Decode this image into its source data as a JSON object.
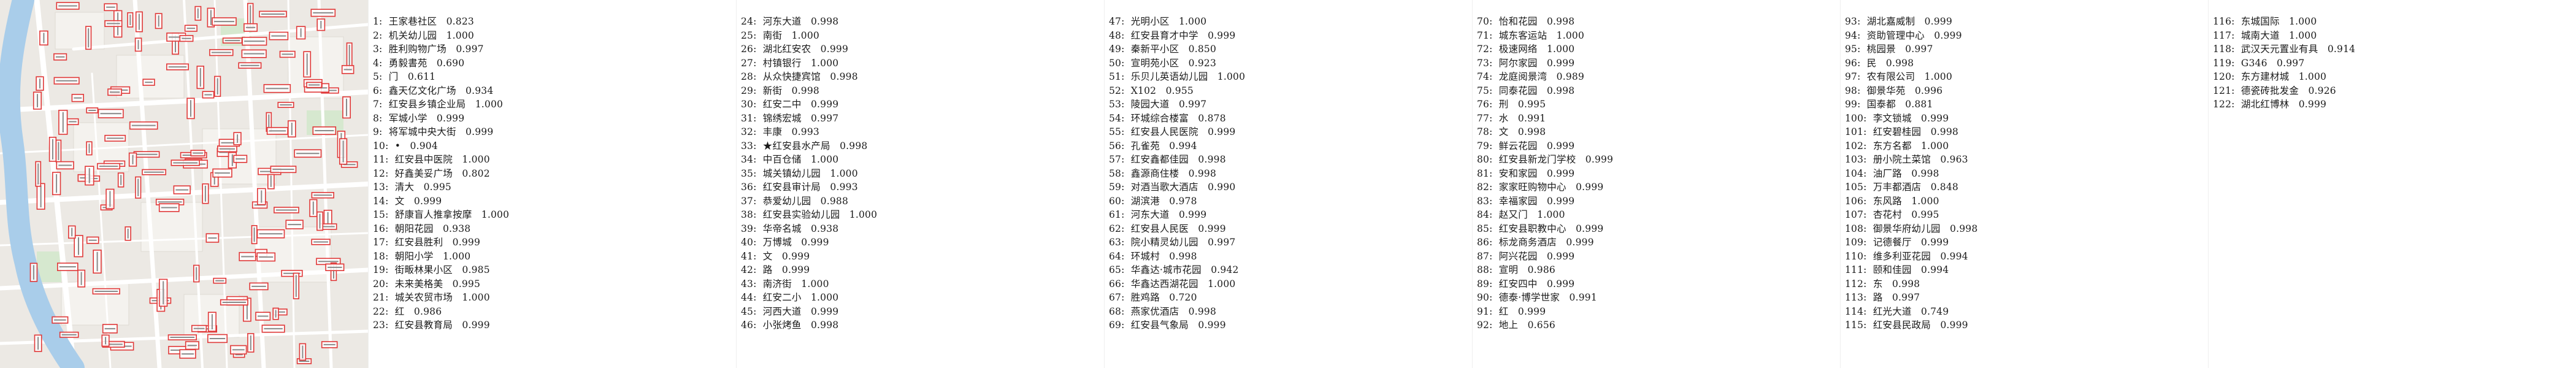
{
  "colors": {
    "map_background": "#ece9e4",
    "river": "#a9cdea",
    "road": "#ffffff",
    "label_box_border": "#e03838",
    "text": "#1a1a1a"
  },
  "map": {
    "label_icon": "red-outlined-label-box-icon"
  },
  "columns": [
    [
      "1:  王家巷社区   0.823",
      "2:  机关幼儿园   1.000",
      "3:  胜利购物广场   0.997",
      "4:  勇毅書苑   0.690",
      "5:  门   0.611",
      "6:  鑫天亿文化广场   0.934",
      "7:  红安县乡镇企业局   1.000",
      "8:  军城小学   0.999",
      "9:  将军城中央大街   0.999",
      "10:  •   0.904",
      "11:  红安县中医院   1.000",
      "12:  好鑫美妥广场   0.802",
      "13:  清大   0.995",
      "14:  文   0.999",
      "15:  舒康盲人推拿按摩   1.000",
      "16:  朝阳花园   0.938",
      "17:  红安县胜利   0.999",
      "18:  朝阳小学   1.000",
      "19:  街畈林果小区   0.985",
      "20:  未来美格美   0.995",
      "21:  城关农贸市场   1.000",
      "22:  红   0.986",
      "23:  红安县教育局   0.999"
    ],
    [
      "24:  河东大道   0.998",
      "25:  南街   1.000",
      "26:  湖北红安农   0.999",
      "27:  村镇银行   1.000",
      "28:  从众快捷宾馆   0.998",
      "29:  新街   0.998",
      "30:  红安二中   0.999",
      "31:  锦绣宏城   0.997",
      "32:  丰康   0.993",
      "33:  ★红安县水产局   0.998",
      "34:  中百仓储   1.000",
      "35:  城关镇幼儿园   1.000",
      "36:  红安县审计局   0.993",
      "37:  恭爱幼儿园   0.988",
      "38:  红安县实验幼儿园   1.000",
      "39:  华帝名城   0.938",
      "40:  万博城   0.999",
      "41:  文   0.999",
      "42:  路   0.999",
      "43:  南济街   1.000",
      "44:  红安二小   1.000",
      "45:  河西大道   0.999",
      "46:  小张烤鱼   0.998"
    ],
    [
      "47:  光明小区   1.000",
      "48:  红安县育才中学   0.999",
      "49:  秦新平小区   0.850",
      "50:  宣明苑小区   0.923",
      "51:  乐贝儿英语幼儿园   1.000",
      "52:  X102   0.955",
      "53:  陵园大道   0.997",
      "54:  环城综合楼富   0.878",
      "55:  红安县人民医院   0.999",
      "56:  孔雀苑   0.994",
      "57:  红安鑫都佳园   0.998",
      "58:  鑫源商住楼   0.998",
      "59:  对酒当歌大酒店   0.990",
      "60:  湖滨港   0.978",
      "61:  河东大道   0.999",
      "62:  红安县人民医   0.999",
      "63:  院小精灵幼儿园   0.997",
      "64:  环城村   0.998",
      "65:  华鑫达·城市花园   0.942",
      "66:  华鑫达西湖花园   1.000",
      "67:  胜鸡路   0.720",
      "68:  燕家优酒店   0.998",
      "69:  红安县气象局   0.999"
    ],
    [
      "70:  怡和花园   0.998",
      "71:  城东客运站   1.000",
      "72:  极速网络   1.000",
      "73:  阿尔家园   0.999",
      "74:  龙庭阅景湾   0.989",
      "75:  同泰花园   0.998",
      "76:  刑   0.995",
      "77:  水   0.991",
      "78:  文   0.998",
      "79:  鲜云花园   0.999",
      "80:  红安县新龙门学校   0.999",
      "81:  安和家园   0.999",
      "82:  家家旺购物中心   0.999",
      "83:  幸福家园   0.999",
      "84:  赵又门   1.000",
      "85:  红安县职教中心   0.999",
      "86:  标龙商务酒店   0.999",
      "87:  阿兴花园   0.999",
      "88:  宣明   0.986",
      "89:  红安四中   0.999",
      "90:  德泰·博学世家   0.991",
      "91:  红   0.999",
      "92:  地上   0.656"
    ],
    [
      "93:  湖北嘉威制   0.999",
      "94:  资助管理中心   0.999",
      "95:  桃园景   0.997",
      "96:  民   0.998",
      "97:  农有限公司   1.000",
      "98:  御景华苑   0.996",
      "99:  国泰都   0.881",
      "100:  李文锁城   0.999",
      "101:  红安碧桂园   0.998",
      "102:  东方名都   1.000",
      "103:  册小院土菜馆   0.963",
      "104:  油厂路   0.998",
      "105:  万丰都酒店   0.848",
      "106:  东风路   1.000",
      "107:  杏花村   0.995",
      "108:  御景华府幼儿园   0.998",
      "109:  记德餐厅   0.999",
      "110:  维多利亚花园   0.994",
      "111:  颐和佳园   0.994",
      "112:  东   0.998",
      "113:  路   0.997",
      "114:  红光大道   0.749",
      "115:  红安县民政局   0.999"
    ],
    [
      "116:  东城国际   1.000",
      "117:  城南大道   1.000",
      "118:  武汉天元置业有具   0.914",
      "119:  G346   0.997",
      "120:  东方建材城   1.000",
      "121:  德瓷砖批发金   0.926",
      "122:  湖北红博林   0.999"
    ]
  ]
}
